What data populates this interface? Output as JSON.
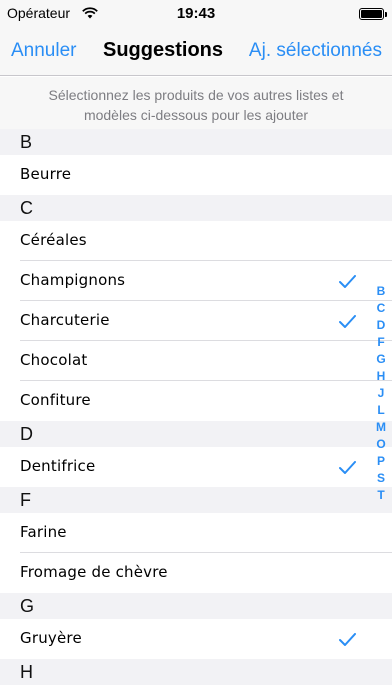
{
  "status_bar": {
    "carrier": "Opérateur",
    "time": "19:43",
    "battery_level": 1.0
  },
  "nav": {
    "cancel": "Annuler",
    "title": "Suggestions",
    "add_selected": "Aj. sélectionnés"
  },
  "hint": {
    "line1": "Sélectionnez les produits de vos autres listes et",
    "line2": "modèles ci-dessous pour les ajouter"
  },
  "sections": [
    {
      "letter": "B",
      "items": [
        {
          "name": "Beurre",
          "checked": false
        }
      ]
    },
    {
      "letter": "C",
      "items": [
        {
          "name": "Céréales",
          "checked": false
        },
        {
          "name": "Champignons",
          "checked": true
        },
        {
          "name": "Charcuterie",
          "checked": true
        },
        {
          "name": "Chocolat",
          "checked": false
        },
        {
          "name": "Confiture",
          "checked": false
        }
      ]
    },
    {
      "letter": "D",
      "items": [
        {
          "name": "Dentifrice",
          "checked": true
        }
      ]
    },
    {
      "letter": "F",
      "items": [
        {
          "name": "Farine",
          "checked": false
        },
        {
          "name": "Fromage de chèvre",
          "checked": false
        }
      ]
    },
    {
      "letter": "G",
      "items": [
        {
          "name": "Gruyère",
          "checked": true
        }
      ]
    },
    {
      "letter": "H",
      "items": []
    }
  ],
  "index_letters": [
    "B",
    "C",
    "D",
    "F",
    "G",
    "H",
    "J",
    "L",
    "M",
    "O",
    "P",
    "S",
    "T"
  ],
  "colors": {
    "accent": "#2a8ef5",
    "section_bg": "#f2f2f5",
    "bar_bg": "#f7f7f7"
  },
  "icons": {
    "wifi": "wifi-icon",
    "battery": "battery-icon",
    "check": "checkmark-icon"
  }
}
